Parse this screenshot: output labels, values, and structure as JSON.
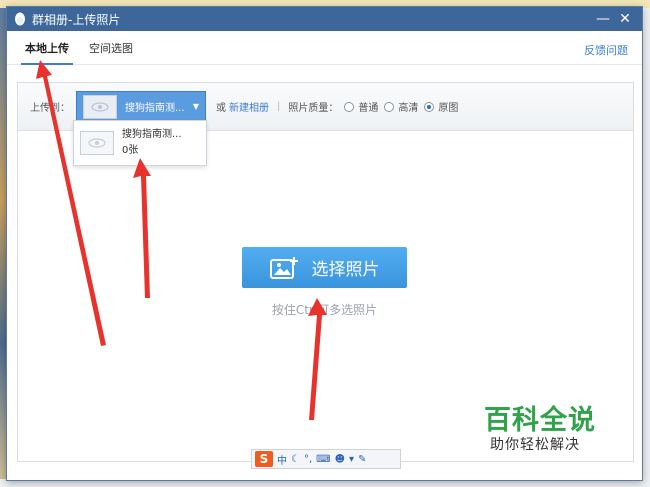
{
  "window": {
    "title": "群相册-上传照片",
    "minimize_label": "—",
    "close_label": "✕"
  },
  "tabs": [
    {
      "label": "本地上传",
      "active": true
    },
    {
      "label": "空间选图",
      "active": false
    }
  ],
  "feedback_label": "反馈问题",
  "toolbar": {
    "upload_to_label": "上传到：",
    "selected_album": "搜狗指南测...",
    "or_label": "或",
    "new_album_label": "新建相册",
    "quality_label": "照片质量：",
    "quality_options": [
      {
        "label": "普通",
        "selected": false
      },
      {
        "label": "高清",
        "selected": false
      },
      {
        "label": "原图",
        "selected": true
      }
    ]
  },
  "dropdown": {
    "album_name": "搜狗指南测...",
    "photo_count": "0张"
  },
  "main": {
    "choose_button_label": "选择照片",
    "hint": "按住Ctrl可多选照片"
  },
  "ime": {
    "logo": "S",
    "mode": "中"
  },
  "watermark": {
    "brand": "百科全说",
    "slogan": "助你轻松解决"
  },
  "colors": {
    "titlebar": "#3d669a",
    "accent": "#3d7dd0",
    "button": "#46a2e6",
    "arrow": "#e8322c",
    "watermark": "#2fa24a"
  },
  "icons": {
    "app": "qq-penguin-icon",
    "choose": "add-photo-icon",
    "thumb": "eye-placeholder-icon"
  }
}
